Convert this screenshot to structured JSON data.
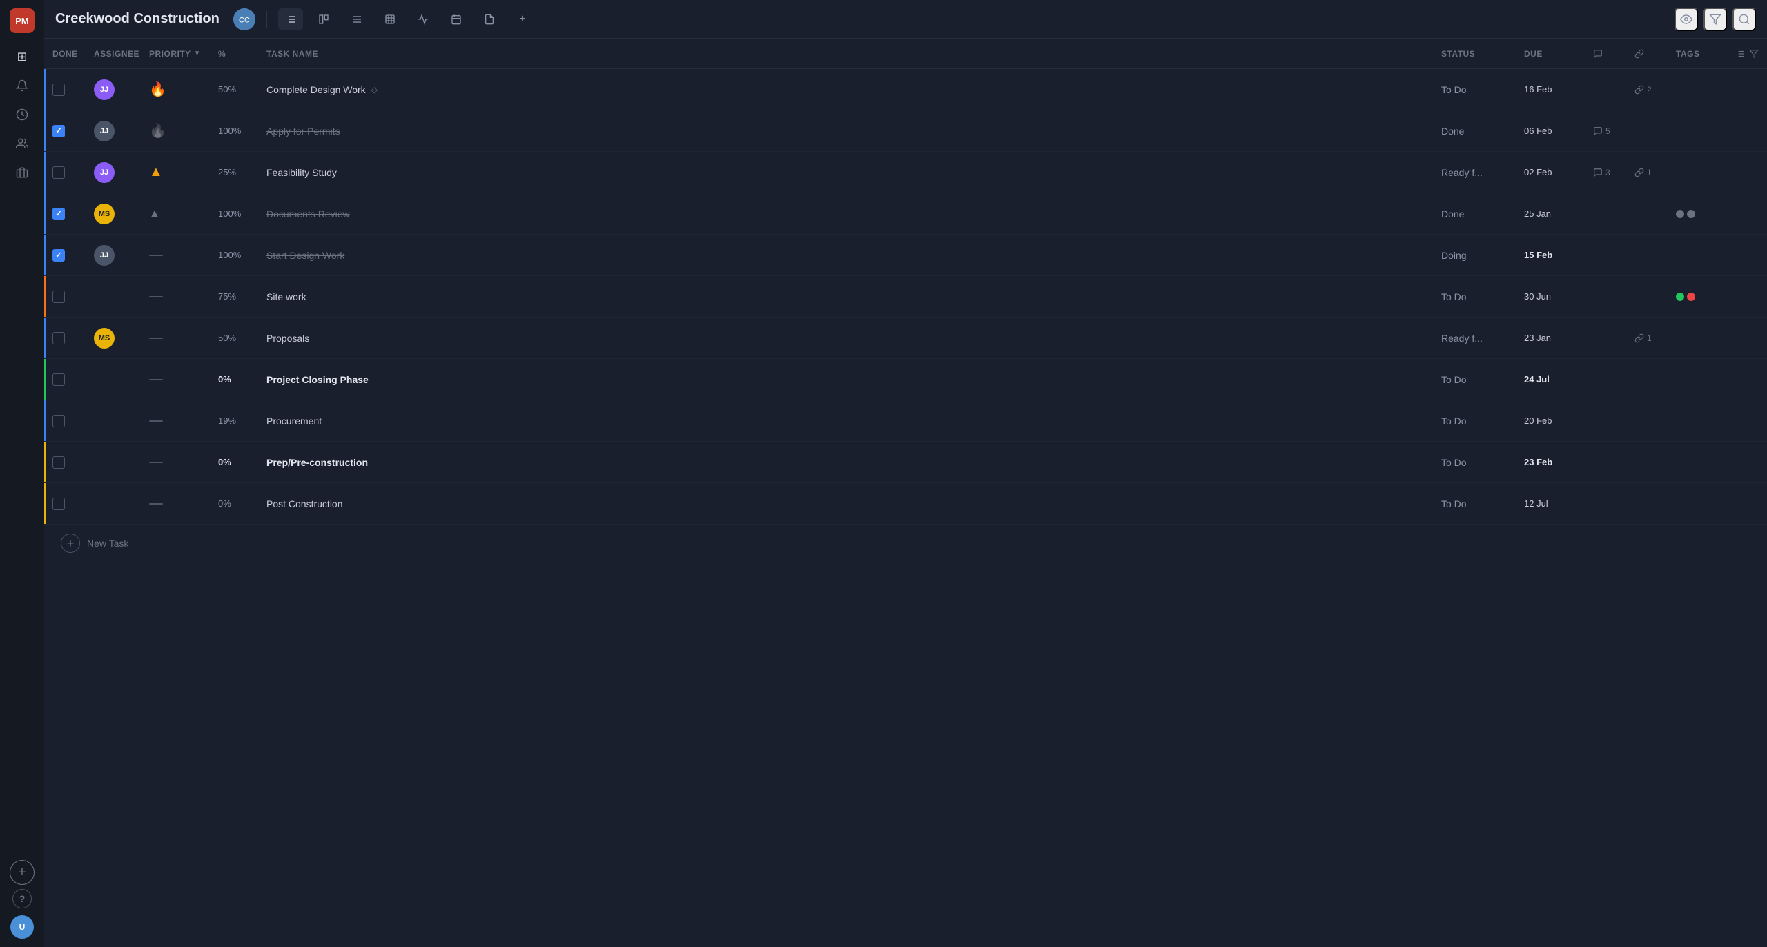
{
  "app": {
    "logo": "PM",
    "project_title": "Creekwood Construction",
    "project_avatar_initials": "CC"
  },
  "sidebar": {
    "icons": [
      {
        "name": "home-icon",
        "symbol": "⊞",
        "active": false
      },
      {
        "name": "notifications-icon",
        "symbol": "🔔",
        "active": false
      },
      {
        "name": "clock-icon",
        "symbol": "🕐",
        "active": false
      },
      {
        "name": "users-icon",
        "symbol": "👥",
        "active": false
      },
      {
        "name": "briefcase-icon",
        "symbol": "💼",
        "active": false
      }
    ],
    "help_icon": "?",
    "add_label": "+"
  },
  "toolbar": {
    "buttons": [
      {
        "name": "list-view-btn",
        "symbol": "☰",
        "active": true
      },
      {
        "name": "board-view-btn",
        "symbol": "⬛",
        "active": false
      },
      {
        "name": "gantt-view-btn",
        "symbol": "≡",
        "active": false
      },
      {
        "name": "table-view-btn",
        "symbol": "⊞",
        "active": false
      },
      {
        "name": "activity-view-btn",
        "symbol": "∿",
        "active": false
      },
      {
        "name": "calendar-view-btn",
        "symbol": "📅",
        "active": false
      },
      {
        "name": "doc-view-btn",
        "symbol": "📄",
        "active": false
      },
      {
        "name": "add-view-btn",
        "symbol": "+",
        "active": false
      }
    ],
    "header_right": [
      {
        "name": "watch-icon",
        "symbol": "👁"
      },
      {
        "name": "filter-icon",
        "symbol": "🔽"
      },
      {
        "name": "search-icon",
        "symbol": "🔍"
      }
    ]
  },
  "columns": {
    "done": "DONE",
    "assignee": "ASSIGNEE",
    "priority": "PRIORITY",
    "percent": "%",
    "task_name": "TASK NAME",
    "status": "STATUS",
    "due": "DUE",
    "tags": "TAGS"
  },
  "tasks": [
    {
      "id": "task-1",
      "checked": false,
      "assignee": "JJ",
      "assignee_color": "purple",
      "priority": "fire",
      "percent": "50%",
      "percent_bold": false,
      "name": "Complete Design Work",
      "name_style": "normal",
      "has_diamond": true,
      "status": "To Do",
      "due": "16 Feb",
      "due_bold": false,
      "comments_count": null,
      "links_count": "2",
      "has_links": true,
      "tags": [],
      "border_color": "blue"
    },
    {
      "id": "task-2",
      "checked": true,
      "assignee": "JJ",
      "assignee_color": "gray",
      "priority": "fire-gray",
      "percent": "100%",
      "percent_bold": false,
      "name": "Apply for Permits",
      "name_style": "strikethrough",
      "has_diamond": false,
      "status": "Done",
      "due": "06 Feb",
      "due_bold": false,
      "comments_count": "5",
      "links_count": null,
      "has_comments": true,
      "tags": [],
      "border_color": "blue"
    },
    {
      "id": "task-3",
      "checked": false,
      "assignee": "JJ",
      "assignee_color": "purple",
      "priority": "up",
      "percent": "25%",
      "percent_bold": false,
      "name": "Feasibility Study",
      "name_style": "normal",
      "has_diamond": false,
      "status": "Ready f...",
      "due": "02 Feb",
      "due_bold": false,
      "comments_count": "3",
      "links_count": "1",
      "has_comments": true,
      "has_links": true,
      "tags": [],
      "border_color": "blue"
    },
    {
      "id": "task-4",
      "checked": true,
      "assignee": "MS",
      "assignee_color": "yellow",
      "priority": "triangle",
      "percent": "100%",
      "percent_bold": false,
      "name": "Documents Review",
      "name_style": "strikethrough",
      "has_diamond": false,
      "status": "Done",
      "due": "25 Jan",
      "due_bold": false,
      "comments_count": null,
      "links_count": null,
      "tags": [
        {
          "color": "#6b7280"
        },
        {
          "color": "#6b7280"
        }
      ],
      "border_color": "blue"
    },
    {
      "id": "task-5",
      "checked": true,
      "assignee": "JJ",
      "assignee_color": "gray",
      "priority": "dash",
      "percent": "100%",
      "percent_bold": false,
      "name": "Start Design Work",
      "name_style": "strikethrough",
      "has_diamond": false,
      "status": "Doing",
      "due": "15 Feb",
      "due_bold": true,
      "comments_count": null,
      "links_count": null,
      "tags": [],
      "border_color": "blue"
    },
    {
      "id": "task-6",
      "checked": false,
      "assignee": null,
      "assignee_color": null,
      "priority": "dash",
      "percent": "75%",
      "percent_bold": false,
      "name": "Site work",
      "name_style": "normal",
      "has_diamond": false,
      "status": "To Do",
      "due": "30 Jun",
      "due_bold": false,
      "comments_count": null,
      "links_count": null,
      "tags": [
        {
          "color": "#22c55e"
        },
        {
          "color": "#ef4444"
        }
      ],
      "border_color": "orange"
    },
    {
      "id": "task-7",
      "checked": false,
      "assignee": "MS",
      "assignee_color": "yellow",
      "priority": "dash",
      "percent": "50%",
      "percent_bold": false,
      "name": "Proposals",
      "name_style": "normal",
      "has_diamond": false,
      "status": "Ready f...",
      "due": "23 Jan",
      "due_bold": false,
      "comments_count": null,
      "links_count": "1",
      "has_links": true,
      "tags": [],
      "border_color": "blue"
    },
    {
      "id": "task-8",
      "checked": false,
      "assignee": null,
      "assignee_color": null,
      "priority": "dash",
      "percent": "0%",
      "percent_bold": true,
      "name": "Project Closing Phase",
      "name_style": "bold",
      "has_diamond": false,
      "status": "To Do",
      "due": "24 Jul",
      "due_bold": true,
      "comments_count": null,
      "links_count": null,
      "tags": [],
      "border_color": "green"
    },
    {
      "id": "task-9",
      "checked": false,
      "assignee": null,
      "assignee_color": null,
      "priority": "dash",
      "percent": "19%",
      "percent_bold": false,
      "name": "Procurement",
      "name_style": "normal",
      "has_diamond": false,
      "status": "To Do",
      "due": "20 Feb",
      "due_bold": false,
      "comments_count": null,
      "links_count": null,
      "tags": [],
      "border_color": "blue"
    },
    {
      "id": "task-10",
      "checked": false,
      "assignee": null,
      "assignee_color": null,
      "priority": "dash",
      "percent": "0%",
      "percent_bold": true,
      "name": "Prep/Pre-construction",
      "name_style": "bold",
      "has_diamond": false,
      "status": "To Do",
      "due": "23 Feb",
      "due_bold": true,
      "comments_count": null,
      "links_count": null,
      "tags": [],
      "border_color": "yellow"
    },
    {
      "id": "task-11",
      "checked": false,
      "assignee": null,
      "assignee_color": null,
      "priority": "dash",
      "percent": "0%",
      "percent_bold": false,
      "name": "Post Construction",
      "name_style": "normal",
      "has_diamond": false,
      "status": "To Do",
      "due": "12 Jul",
      "due_bold": false,
      "comments_count": null,
      "links_count": null,
      "tags": [],
      "border_color": "yellow"
    }
  ],
  "footer": {
    "add_task_label": "New Task",
    "add_btn": "+"
  }
}
